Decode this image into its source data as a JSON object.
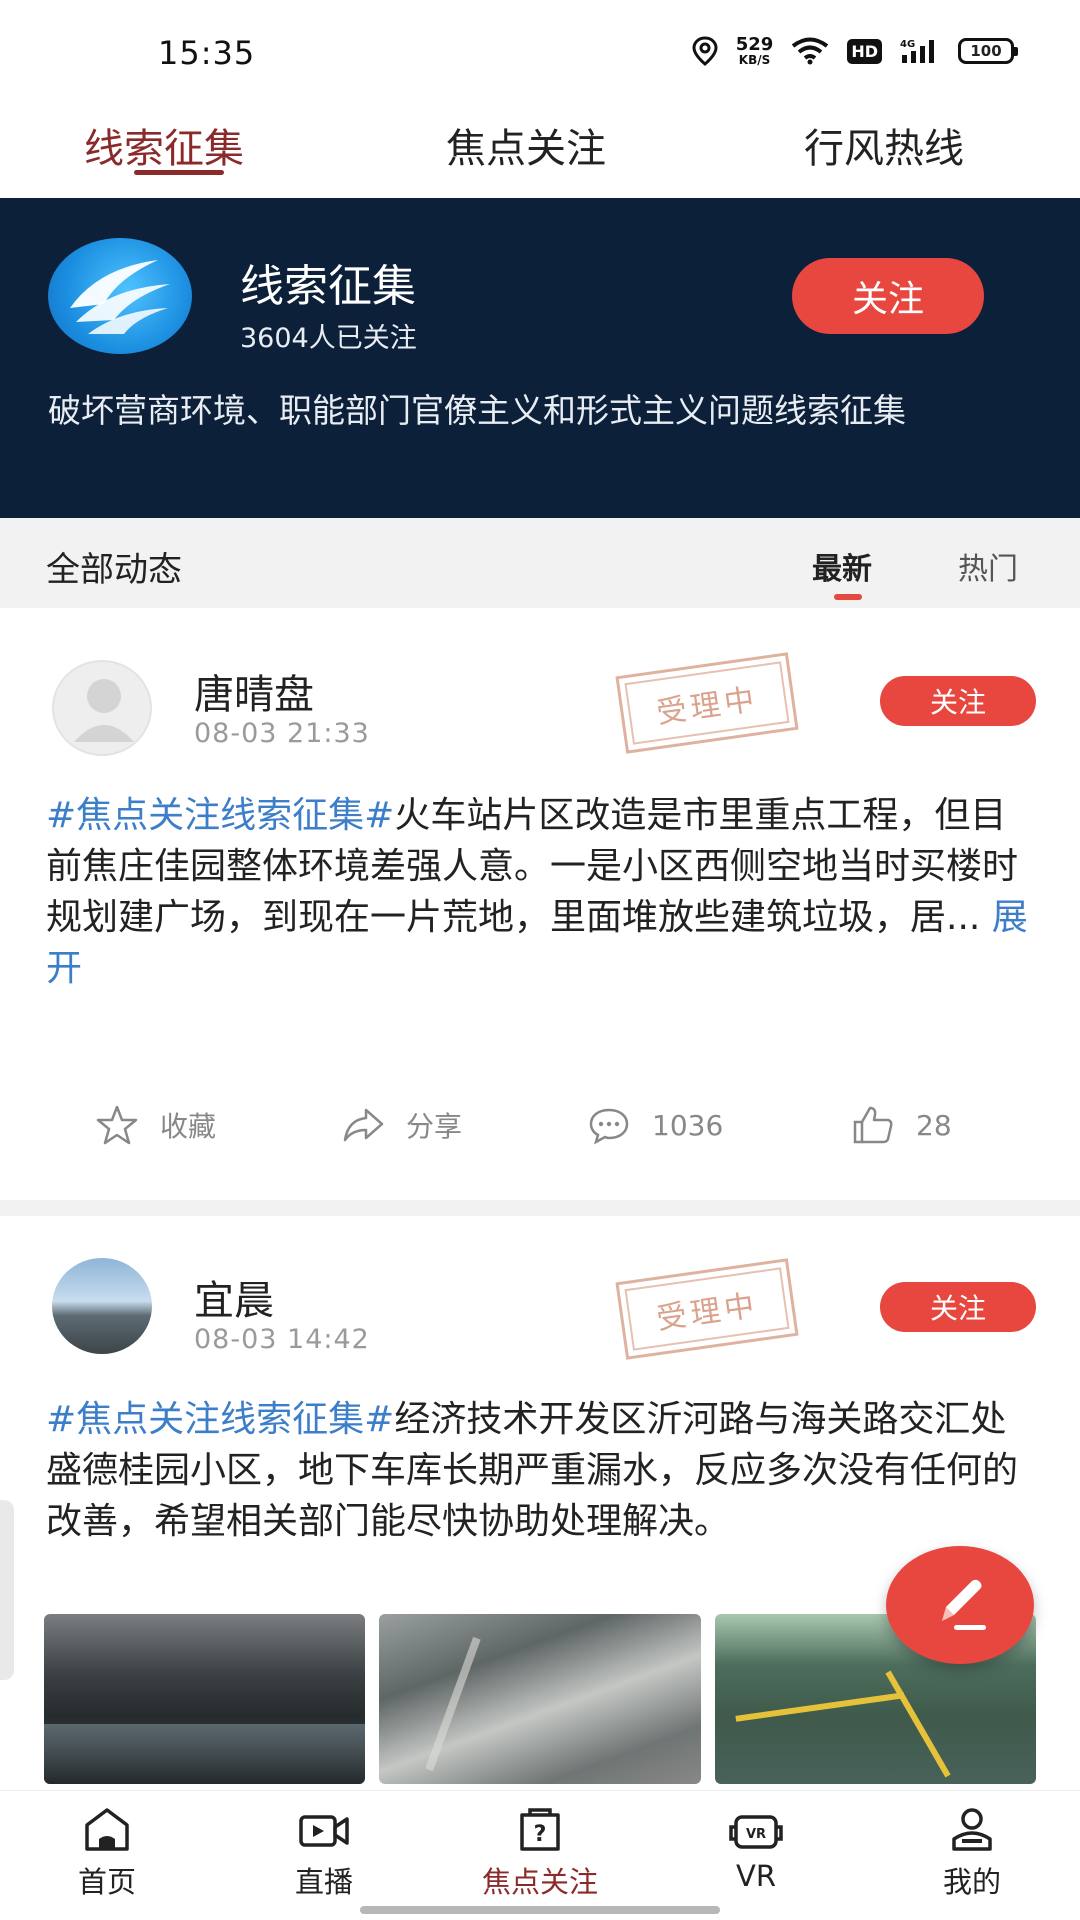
{
  "status_bar": {
    "time": "15:35",
    "net_speed": "529",
    "net_unit": "KB/S",
    "hd": "HD",
    "network": "4G",
    "battery": "100"
  },
  "top_tabs": [
    {
      "label": "线索征集",
      "active": true
    },
    {
      "label": "焦点关注",
      "active": false
    },
    {
      "label": "行风热线",
      "active": false
    }
  ],
  "channel": {
    "title": "线索征集",
    "followers": "3604人已关注",
    "follow_label": "关注",
    "description": "破坏营商环境、职能部门官僚主义和形式主义问题线索征集"
  },
  "feed_filter": {
    "title": "全部动态",
    "tabs": [
      {
        "label": "最新",
        "active": true
      },
      {
        "label": "热门",
        "active": false
      }
    ]
  },
  "posts": [
    {
      "author": "唐晴盘",
      "time": "08-03 21:33",
      "stamp": "受理中",
      "follow_label": "关注",
      "hashtag": "#焦点关注线索征集#",
      "text": "火车站片区改造是市里重点工程，但目前焦庄佳园整体环境差强人意。一是小区西侧空地当时买楼时规划建广场，到现在一片荒地，里面堆放些建筑垃圾，居...",
      "expand_label": "展开",
      "actions": {
        "favorite": "收藏",
        "share": "分享",
        "comments": "1036",
        "likes": "28"
      }
    },
    {
      "author": "宜晨",
      "time": "08-03 14:42",
      "stamp": "受理中",
      "follow_label": "关注",
      "hashtag": "#焦点关注线索征集#",
      "text": "经济技术开发区沂河路与海关路交汇处盛德桂园小区，地下车库长期严重漏水，反应多次没有任何的改善，希望相关部门能尽快协助处理解决。"
    }
  ],
  "bottom_nav": [
    {
      "label": "首页",
      "icon": "home-icon",
      "active": false
    },
    {
      "label": "直播",
      "icon": "video-camera-icon",
      "active": false
    },
    {
      "label": "焦点关注",
      "icon": "question-bag-icon",
      "active": true
    },
    {
      "label": "VR",
      "icon": "vr-headset-icon",
      "active": false
    },
    {
      "label": "我的",
      "icon": "user-profile-icon",
      "active": false
    }
  ],
  "colors": {
    "accent_red": "#e8473f",
    "active_tab": "#8b2a2a",
    "banner_bg": "#0d2039",
    "hashtag_blue": "#3d7ec9"
  }
}
